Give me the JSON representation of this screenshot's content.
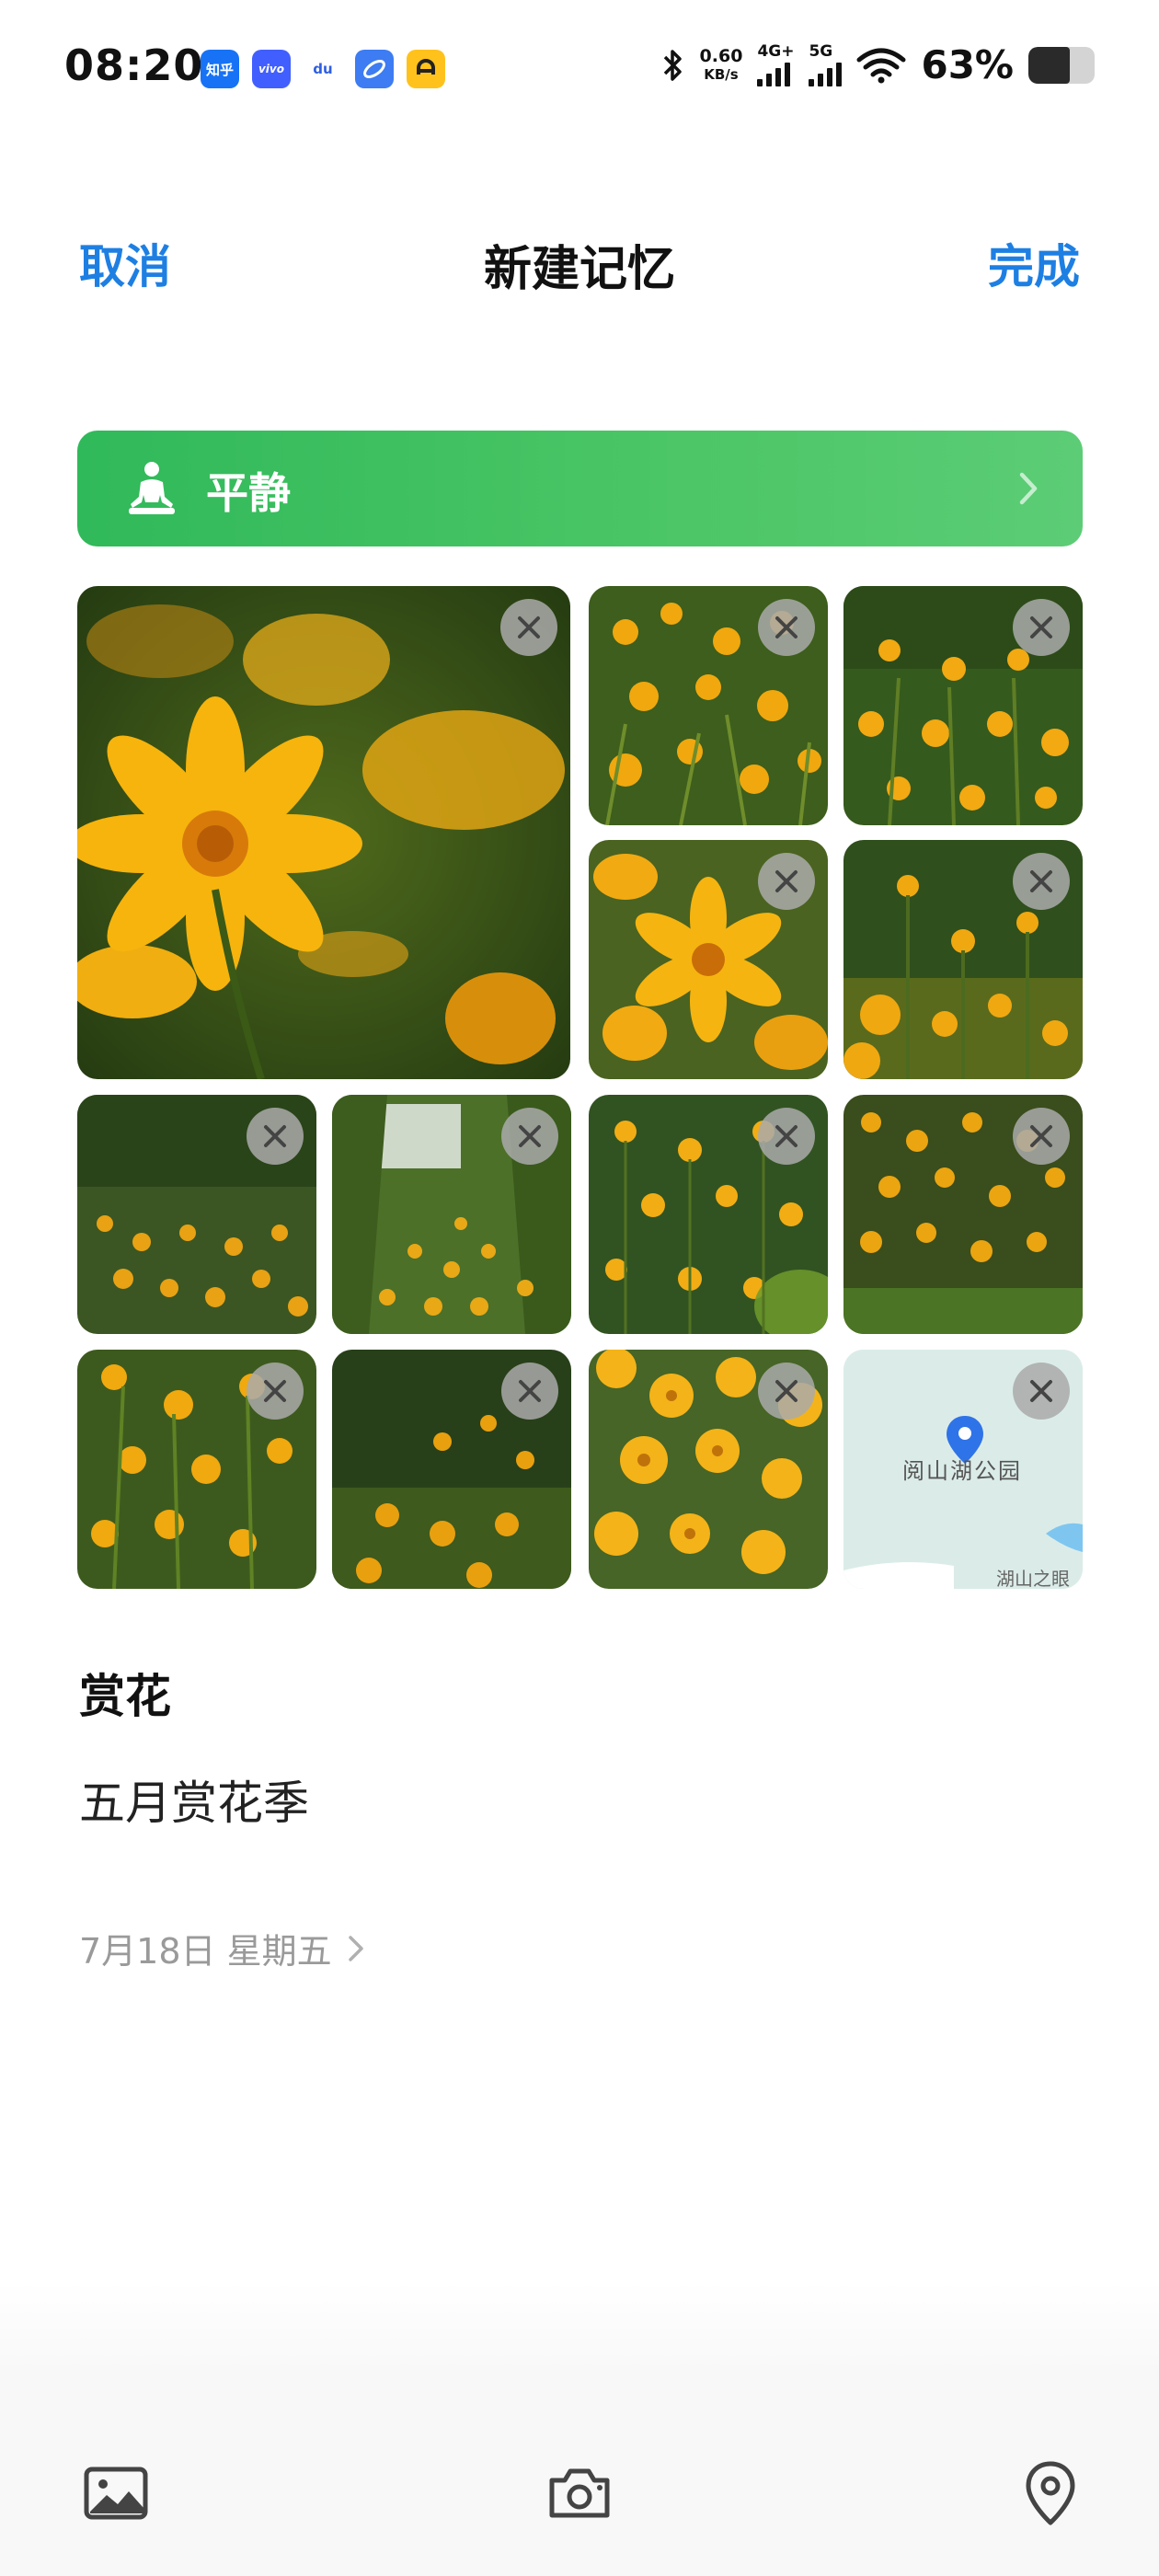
{
  "status_bar": {
    "time": "08:20",
    "app_icons": [
      {
        "name": "zhihu-icon",
        "label": "知乎",
        "color": "#1772f6"
      },
      {
        "name": "vivo-icon",
        "label": "vivo",
        "color": "#415fff"
      },
      {
        "name": "baidu-icon",
        "label": "du",
        "color": "#ffffff"
      },
      {
        "name": "browser-icon",
        "label": "",
        "color": "#3d7cf2"
      },
      {
        "name": "app-yellow-icon",
        "label": "",
        "color": "#ffc21c"
      }
    ],
    "net_speed_value": "0.60",
    "net_speed_unit": "KB/s",
    "net_type_1": "4G+",
    "net_type_2": "5G",
    "battery_percent": "63%",
    "battery_level": 0.63
  },
  "header": {
    "cancel_label": "取消",
    "title": "新建记忆",
    "done_label": "完成"
  },
  "mood": {
    "label": "平静",
    "icon": "meditation-icon"
  },
  "media": {
    "photos": [
      {
        "name": "photo-1",
        "alt": "coreopsis close-up"
      },
      {
        "name": "photo-2",
        "alt": "coreopsis field"
      },
      {
        "name": "photo-3",
        "alt": "coreopsis field"
      },
      {
        "name": "photo-4",
        "alt": "coreopsis bloom"
      },
      {
        "name": "photo-5",
        "alt": "coreopsis field"
      },
      {
        "name": "photo-6",
        "alt": "coreopsis field"
      },
      {
        "name": "photo-7",
        "alt": "coreopsis path"
      },
      {
        "name": "photo-8",
        "alt": "coreopsis field"
      },
      {
        "name": "photo-9",
        "alt": "coreopsis field"
      },
      {
        "name": "photo-10",
        "alt": "coreopsis field"
      },
      {
        "name": "photo-11",
        "alt": "coreopsis field"
      },
      {
        "name": "photo-12",
        "alt": "coreopsis cluster"
      }
    ],
    "map": {
      "place_label": "阅山湖公园",
      "secondary_label": "湖山之眼"
    },
    "remove_icon": "close-icon"
  },
  "memory": {
    "title": "赏花",
    "description": "五月赏花季",
    "date": "7月18日 星期五"
  },
  "toolbar": {
    "items": [
      {
        "name": "gallery-icon"
      },
      {
        "name": "camera-icon"
      },
      {
        "name": "location-pin-icon"
      }
    ]
  },
  "colors": {
    "accent_blue": "#1e7fe3",
    "mood_green": "#3dbf5e",
    "flower_yellow": "#f2a60c"
  }
}
